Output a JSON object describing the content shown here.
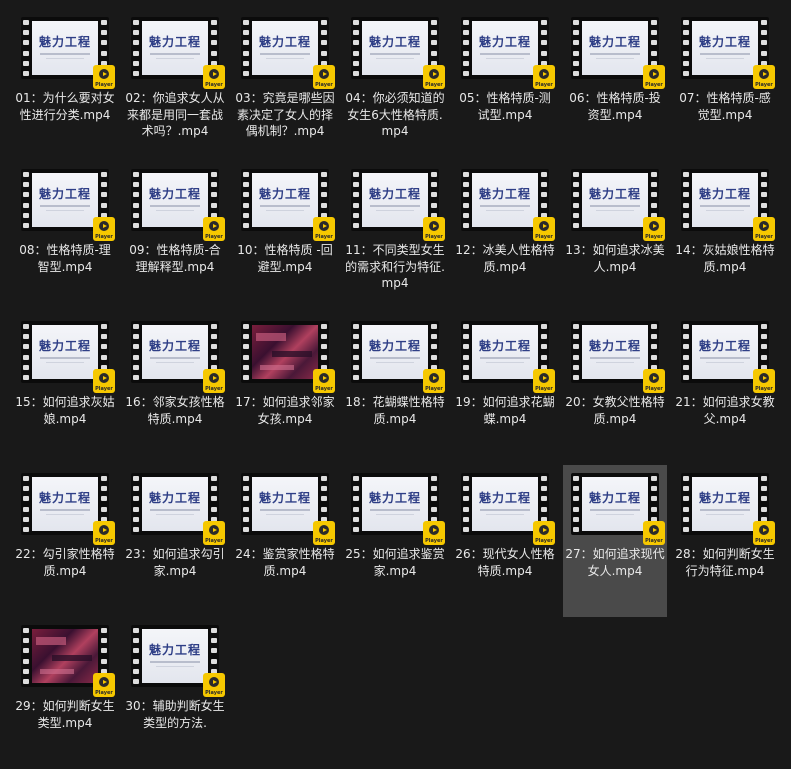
{
  "colors": {
    "background": "#191919",
    "selected_tile": "#4a4a4a",
    "label_text": "#e8e8e8",
    "player_badge": "#f6c800",
    "brand_text": "#2e3e86"
  },
  "thumbnail": {
    "brand_text": "魅力工程",
    "badge_text": "Player",
    "badge_icon": "play-icon"
  },
  "files": [
    {
      "name": "01：为什么要对女性进行分类.mp4",
      "thumb": "title"
    },
    {
      "name": "02：你追求女人从来都是用同一套战术吗？.mp4",
      "thumb": "title"
    },
    {
      "name": "03：究竟是哪些因素决定了女人的择偶机制？.mp4",
      "thumb": "title"
    },
    {
      "name": "04：你必须知道的女生6大性格特质.mp4",
      "thumb": "title"
    },
    {
      "name": "05：性格特质-测试型.mp4",
      "thumb": "title"
    },
    {
      "name": "06：性格特质-投资型.mp4",
      "thumb": "title"
    },
    {
      "name": "07：性格特质-感觉型.mp4",
      "thumb": "title"
    },
    {
      "name": "08：性格特质-理智型.mp4",
      "thumb": "title"
    },
    {
      "name": "09：性格特质-合理解释型.mp4",
      "thumb": "title"
    },
    {
      "name": "10：性格特质 -回避型.mp4",
      "thumb": "title"
    },
    {
      "name": "11：不同类型女生的需求和行为特征.mp4",
      "thumb": "title"
    },
    {
      "name": "12：冰美人性格特质.mp4",
      "thumb": "title"
    },
    {
      "name": "13：如何追求冰美人.mp4",
      "thumb": "title"
    },
    {
      "name": "14：灰姑娘性格特质.mp4",
      "thumb": "title"
    },
    {
      "name": "15：如何追求灰姑娘.mp4",
      "thumb": "title"
    },
    {
      "name": "16：邻家女孩性格特质.mp4",
      "thumb": "title"
    },
    {
      "name": "17：如何追求邻家女孩.mp4",
      "thumb": "video"
    },
    {
      "name": "18：花蝴蝶性格特质.mp4",
      "thumb": "title"
    },
    {
      "name": "19：如何追求花蝴蝶.mp4",
      "thumb": "title"
    },
    {
      "name": "20：女教父性格特质.mp4",
      "thumb": "title"
    },
    {
      "name": "21：如何追求女教父.mp4",
      "thumb": "title"
    },
    {
      "name": "22：勾引家性格特质.mp4",
      "thumb": "title"
    },
    {
      "name": "23：如何追求勾引家.mp4",
      "thumb": "title"
    },
    {
      "name": "24：鉴赏家性格特质.mp4",
      "thumb": "title"
    },
    {
      "name": "25：如何追求鉴赏家.mp4",
      "thumb": "title"
    },
    {
      "name": "26：现代女人性格特质.mp4",
      "thumb": "title"
    },
    {
      "name": "27：如何追求现代女人.mp4",
      "thumb": "title",
      "selected": true
    },
    {
      "name": "28：如何判断女生行为特征.mp4",
      "thumb": "title"
    },
    {
      "name": "29：如何判断女生类型.mp4",
      "thumb": "video"
    },
    {
      "name": "30：辅助判断女生类型的方法.",
      "thumb": "title"
    }
  ]
}
